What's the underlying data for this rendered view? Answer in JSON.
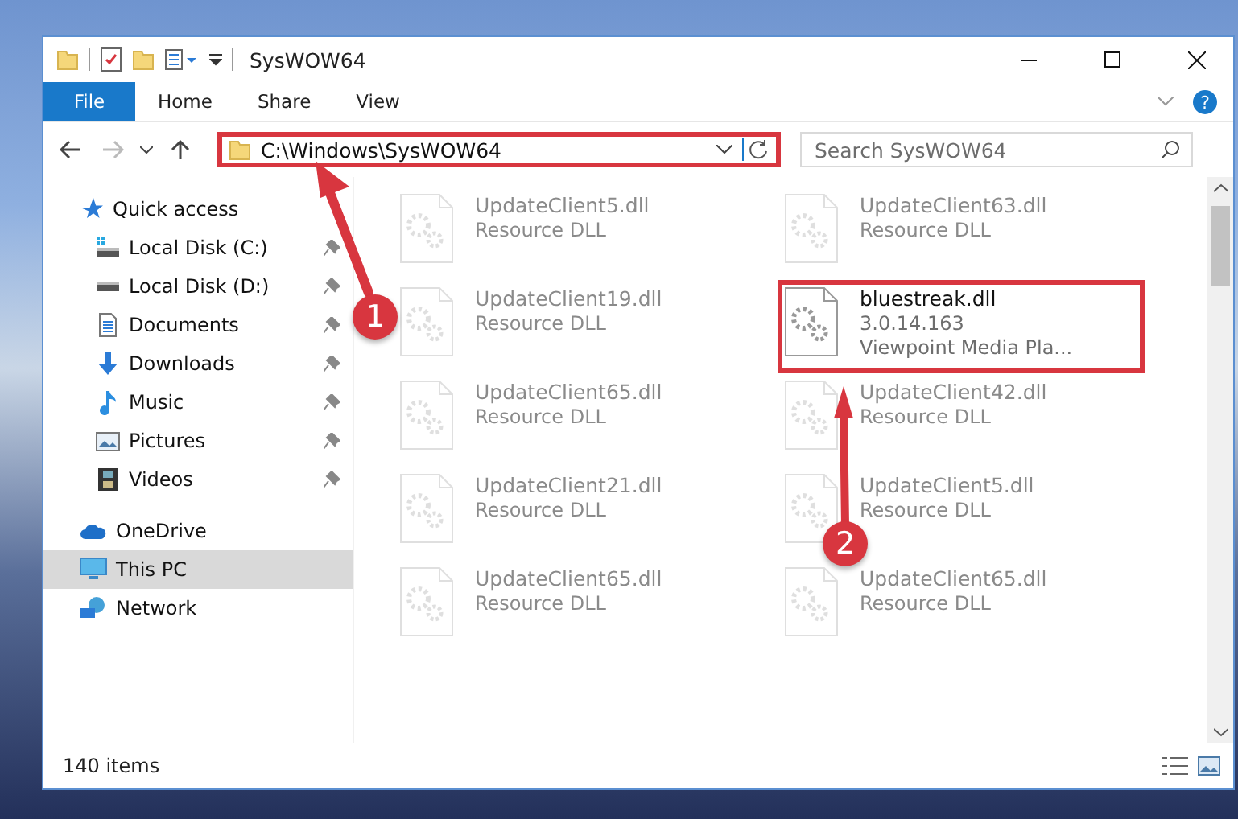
{
  "window": {
    "title": "SysWOW64"
  },
  "ribbon": {
    "file_tab": "File",
    "tabs": [
      "Home",
      "Share",
      "View"
    ]
  },
  "address": {
    "path": "C:\\Windows\\SysWOW64",
    "highlighted": true
  },
  "search": {
    "placeholder": "Search SysWOW64"
  },
  "help": {
    "label": "?"
  },
  "nav": [
    {
      "label": "Quick access",
      "kind": "star",
      "selected": false,
      "children": [
        {
          "label": "Local Disk (C:)",
          "kind": "system-drive",
          "pinned": true,
          "selected": false
        },
        {
          "label": "Local Disk (D:)",
          "kind": "drive",
          "pinned": true,
          "selected": false
        },
        {
          "label": "Documents",
          "kind": "documents",
          "pinned": true,
          "selected": false
        },
        {
          "label": "Downloads",
          "kind": "downloads",
          "pinned": true,
          "selected": false
        },
        {
          "label": "Music",
          "kind": "music",
          "pinned": true,
          "selected": false
        },
        {
          "label": "Pictures",
          "kind": "pictures",
          "pinned": true,
          "selected": false
        },
        {
          "label": "Videos",
          "kind": "videos",
          "pinned": true,
          "selected": false
        }
      ]
    },
    {
      "label": "OneDrive",
      "kind": "cloud",
      "selected": false
    },
    {
      "label": "This PC",
      "kind": "pc",
      "selected": true
    },
    {
      "label": "Network",
      "kind": "network",
      "selected": false
    }
  ],
  "files": [
    {
      "name": "UpdateClient5.dll",
      "details": [
        "Resource DLL"
      ],
      "faded": true,
      "highlighted": false
    },
    {
      "name": "UpdateClient63.dll",
      "details": [
        "Resource DLL"
      ],
      "faded": true,
      "highlighted": false
    },
    {
      "name": "UpdateClient19.dll",
      "details": [
        "Resource DLL"
      ],
      "faded": true,
      "highlighted": false
    },
    {
      "name": "bluestreak.dll",
      "details": [
        "3.0.14.163",
        "Viewpoint Media Pla..."
      ],
      "faded": false,
      "highlighted": true
    },
    {
      "name": "UpdateClient65.dll",
      "details": [
        "Resource DLL"
      ],
      "faded": true,
      "highlighted": false
    },
    {
      "name": "UpdateClient42.dll",
      "details": [
        "Resource DLL"
      ],
      "faded": true,
      "highlighted": false
    },
    {
      "name": "UpdateClient21.dll",
      "details": [
        "Resource DLL"
      ],
      "faded": true,
      "highlighted": false
    },
    {
      "name": "UpdateClient5.dll",
      "details": [
        "Resource DLL"
      ],
      "faded": true,
      "highlighted": false
    },
    {
      "name": "UpdateClient65.dll",
      "details": [
        "Resource DLL"
      ],
      "faded": true,
      "highlighted": false
    },
    {
      "name": "UpdateClient65.dll",
      "details": [
        "Resource DLL"
      ],
      "faded": true,
      "highlighted": false
    }
  ],
  "status_bar": {
    "count": "140 items"
  },
  "annotations": [
    {
      "label": "1"
    },
    {
      "label": "2"
    }
  ]
}
